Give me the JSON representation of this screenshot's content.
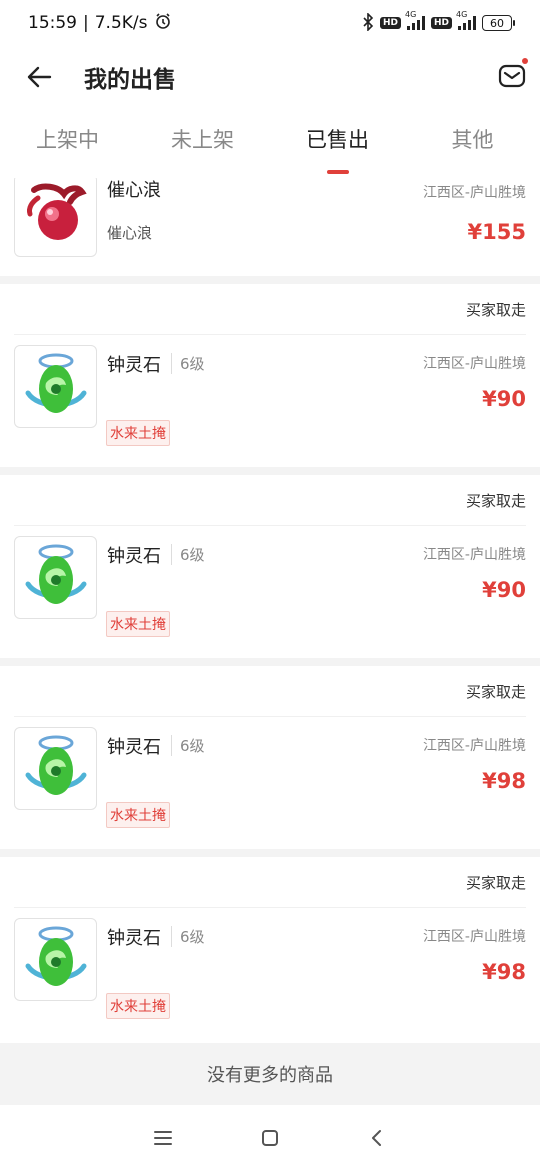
{
  "status_bar": {
    "time": "15:59",
    "network_speed": "7.5K/s",
    "hd1": "HD",
    "hd2": "HD",
    "net1": "4G",
    "net2": "4G",
    "battery": "60"
  },
  "header": {
    "title": "我的出售"
  },
  "tabs": [
    {
      "label": "上架中",
      "active": false
    },
    {
      "label": "未上架",
      "active": false
    },
    {
      "label": "已售出",
      "active": true
    },
    {
      "label": "其他",
      "active": false
    }
  ],
  "items": [
    {
      "name": "催心浪",
      "subtitle": "催心浪",
      "server": "江西区-庐山胜境",
      "price": "¥155"
    },
    {
      "status": "买家取走",
      "name": "钟灵石",
      "level": "6级",
      "server": "江西区-庐山胜境",
      "price": "¥90",
      "tag": "水来土掩"
    },
    {
      "status": "买家取走",
      "name": "钟灵石",
      "level": "6级",
      "server": "江西区-庐山胜境",
      "price": "¥90",
      "tag": "水来土掩"
    },
    {
      "status": "买家取走",
      "name": "钟灵石",
      "level": "6级",
      "server": "江西区-庐山胜境",
      "price": "¥98",
      "tag": "水来土掩"
    },
    {
      "status": "买家取走",
      "name": "钟灵石",
      "level": "6级",
      "server": "江西区-庐山胜境",
      "price": "¥98",
      "tag": "水来土掩"
    }
  ],
  "footer": {
    "no_more": "没有更多的商品"
  },
  "colors": {
    "accent": "#e0403a"
  },
  "icons": {
    "back": "arrow-left-icon",
    "mail": "mail-icon",
    "nav_menu": "menu-icon",
    "nav_home": "home-square-icon",
    "nav_back": "chevron-left-icon"
  }
}
